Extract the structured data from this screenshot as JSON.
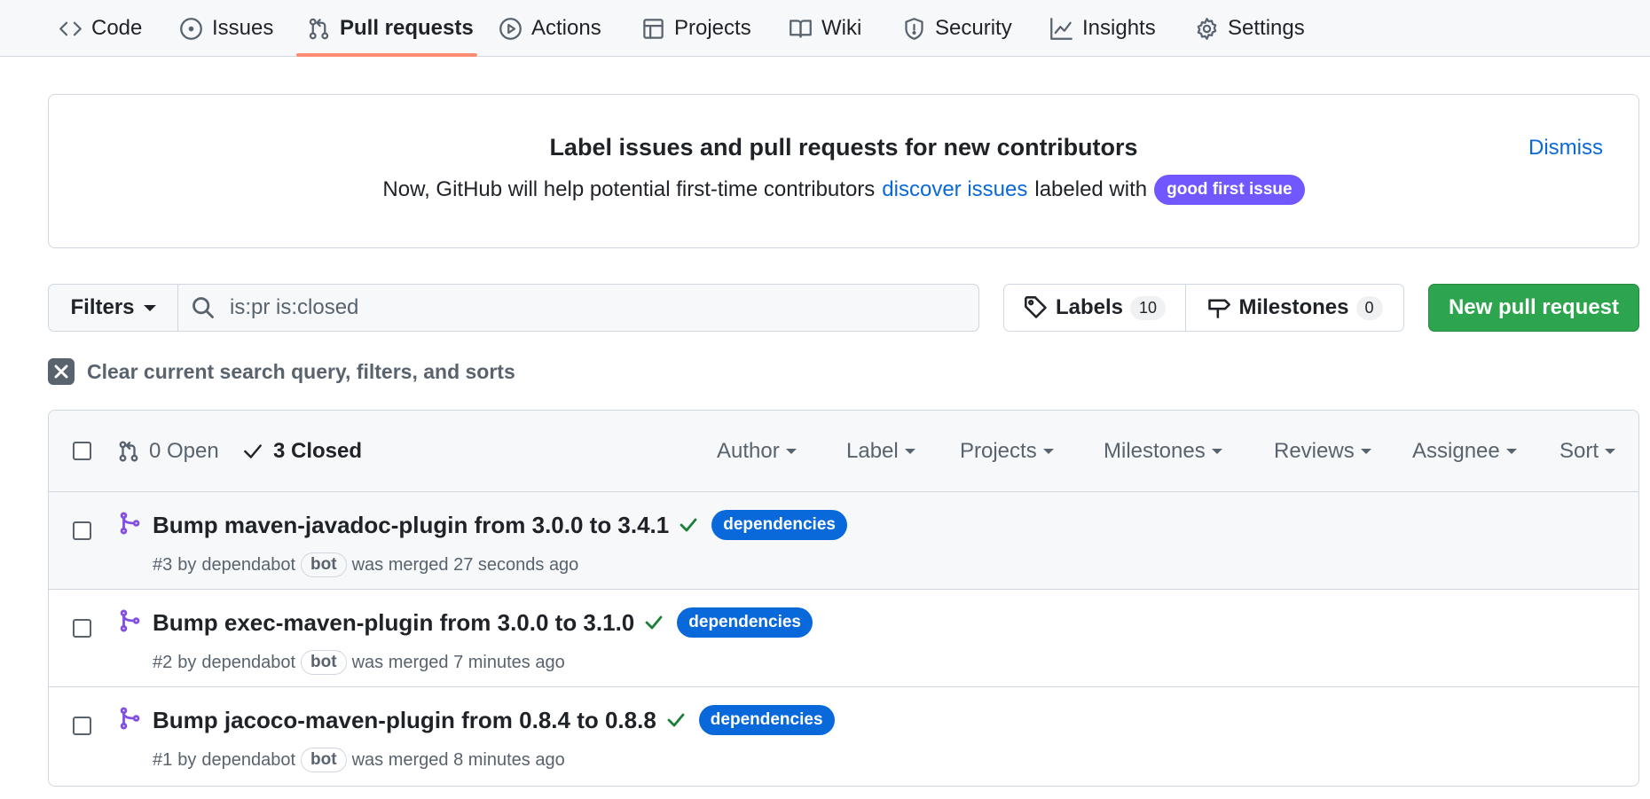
{
  "nav": {
    "items": [
      {
        "label": "Code",
        "icon": "code-icon"
      },
      {
        "label": "Issues",
        "icon": "issue-opened-icon"
      },
      {
        "label": "Pull requests",
        "icon": "git-pull-request-icon"
      },
      {
        "label": "Actions",
        "icon": "play-icon"
      },
      {
        "label": "Projects",
        "icon": "table-icon"
      },
      {
        "label": "Wiki",
        "icon": "book-icon"
      },
      {
        "label": "Security",
        "icon": "shield-icon"
      },
      {
        "label": "Insights",
        "icon": "graph-icon"
      },
      {
        "label": "Settings",
        "icon": "gear-icon"
      }
    ],
    "active": "Pull requests"
  },
  "banner": {
    "title": "Label issues and pull requests for new contributors",
    "desc_prefix": "Now, GitHub will help potential first-time contributors",
    "desc_link": "discover issues",
    "desc_suffix": "labeled with",
    "label": "good first issue",
    "label_color": "#7057ff",
    "dismiss": "Dismiss"
  },
  "toolbar": {
    "filters_label": "Filters",
    "search_value": "is:pr is:closed",
    "labels_label": "Labels",
    "labels_count": "10",
    "milestones_label": "Milestones",
    "milestones_count": "0",
    "new_pr_label": "New pull request",
    "new_pr_color": "#2da44e"
  },
  "clear_query": "Clear current search query, filters, and sorts",
  "list_header": {
    "open_label": "0 Open",
    "closed_label": "3 Closed",
    "sort_menus": [
      "Author",
      "Label",
      "Projects",
      "Milestones",
      "Reviews",
      "Assignee",
      "Sort"
    ]
  },
  "pull_requests": [
    {
      "title": "Bump maven-javadoc-plugin from 3.0.0 to 3.4.1",
      "label": "dependencies",
      "number": "#3",
      "by": "by",
      "author": "dependabot",
      "badge": "bot",
      "status": "was merged 27 seconds ago"
    },
    {
      "title": "Bump exec-maven-plugin from 3.0.0 to 3.1.0",
      "label": "dependencies",
      "number": "#2",
      "by": "by",
      "author": "dependabot",
      "badge": "bot",
      "status": "was merged 7 minutes ago"
    },
    {
      "title": "Bump jacoco-maven-plugin from 0.8.4 to 0.8.8",
      "label": "dependencies",
      "number": "#1",
      "by": "by",
      "author": "dependabot",
      "badge": "bot",
      "status": "was merged 8 minutes ago"
    }
  ],
  "colors": {
    "merged": "#8250df",
    "check": "#1a7f37",
    "dependencies_label": "#0969da",
    "nav_active_underline": "#fd8c73"
  }
}
